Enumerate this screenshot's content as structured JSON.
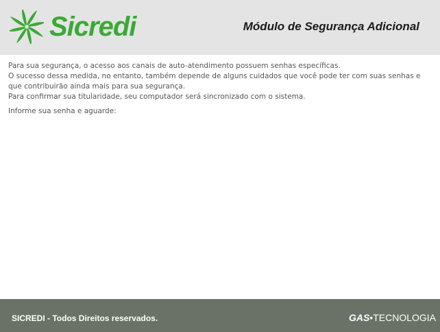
{
  "header": {
    "logo_text": "Sicredi",
    "logo_icon": "sicredi-pinwheel-icon",
    "module_title": "Módulo de Segurança Adicional"
  },
  "content": {
    "paragraphs": [
      "Para sua segurança, o acesso aos canais de auto-atendimento possuem senhas específicas.",
      "O sucesso dessa medida, no entanto, também depende de alguns cuidados que você pode ter com suas senhas e que contribuirão ainda mais para sua segurança.",
      "Para confirmar sua titularidade, seu computador será sincronizado com o sistema."
    ],
    "prompt": "Informe sua senha e aguarde:"
  },
  "footer": {
    "copyright": "SICREDI -  Todos Direitos reservados.",
    "vendor_gas": "GAS",
    "vendor_dot": "•",
    "vendor_tecnologia": "TECNOLOGIA"
  },
  "colors": {
    "brand_green": "#3aa935",
    "header_bg": "#e4e4e4",
    "footer_bg": "#6a7267",
    "body_text": "#555555"
  }
}
